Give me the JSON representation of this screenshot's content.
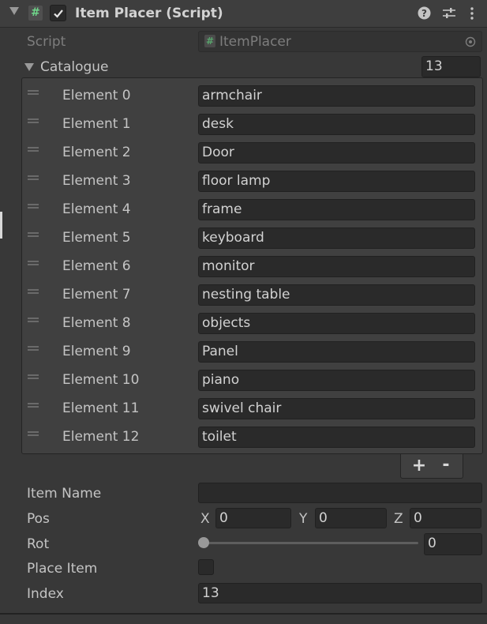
{
  "header": {
    "title": "Item Placer (Script)",
    "enabled": true,
    "icons": [
      "collapse-arrow-icon",
      "csharp-script-icon",
      "help-icon",
      "preset-icon",
      "kebab-menu-icon"
    ]
  },
  "script": {
    "label": "Script",
    "value": "ItemPlacer",
    "icon": "csharp-script-icon"
  },
  "catalogue": {
    "label": "Catalogue",
    "size": "13",
    "elements": [
      {
        "label": "Element 0",
        "value": "armchair"
      },
      {
        "label": "Element 1",
        "value": "desk"
      },
      {
        "label": "Element 2",
        "value": "Door"
      },
      {
        "label": "Element 3",
        "value": "floor lamp"
      },
      {
        "label": "Element 4",
        "value": "frame"
      },
      {
        "label": "Element 5",
        "value": "keyboard"
      },
      {
        "label": "Element 6",
        "value": "monitor"
      },
      {
        "label": "Element 7",
        "value": "nesting table"
      },
      {
        "label": "Element 8",
        "value": "objects"
      },
      {
        "label": "Element 9",
        "value": "Panel"
      },
      {
        "label": "Element 10",
        "value": "piano"
      },
      {
        "label": "Element 11",
        "value": "swivel chair"
      },
      {
        "label": "Element 12",
        "value": "toilet"
      }
    ],
    "add_label": "+",
    "remove_label": "-"
  },
  "fields": {
    "item_name": {
      "label": "Item Name",
      "value": ""
    },
    "pos": {
      "label": "Pos",
      "x_label": "X",
      "x": "0",
      "y_label": "Y",
      "y": "0",
      "z_label": "Z",
      "z": "0"
    },
    "rot": {
      "label": "Rot",
      "value": "0",
      "slider_fraction": 0
    },
    "place_item": {
      "label": "Place Item",
      "checked": false
    },
    "index": {
      "label": "Index",
      "value": "13"
    }
  },
  "colors": {
    "background": "#383838",
    "header": "#3e3e3e",
    "field": "#2a2a2a",
    "script_icon": "#6fd68a"
  }
}
